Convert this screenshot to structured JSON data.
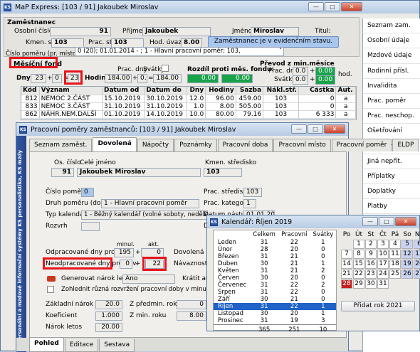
{
  "main_window": {
    "title": "MaP Express: [103 / 91] Jakoubek Miroslav",
    "section_employee": "Zaměstnanec",
    "osobni_cislo_label": "Osobní číslo",
    "osobni_cislo": "91",
    "prijmeni_label": "Příjmení",
    "prijmeni": "Jakoubek",
    "jmeno_label": "Jméno",
    "jmeno": "Miroslav",
    "titul_label": "Titul:",
    "kmen_str_label": "Kmen. stř.:",
    "kmen_str": "103",
    "prac_str_label": "Prac. stř.:",
    "prac_str": "103",
    "hod_uvazek_label": "Hod. úvazek",
    "hod_uvazek": "8.00",
    "status_button": "Zaměstnanec je v evidenčním stavu.",
    "cislo_pomeru_label": "Číslo poměru (pr. místo):",
    "cislo_pomeru_value": "0  (20); 01.01.2014 - ; 1 - Hlavní pracovní poměr; 103,",
    "mesicni_fond": "Měsíční fond",
    "prac_dny_label": "Prac. dny",
    "svatky_label": "Svátky",
    "dny_label": "Dny:",
    "dny_a": "23",
    "dny_b": "0",
    "dny_c": "23",
    "hodiny_label": "Hodiny:",
    "hodiny_a": "184.00",
    "hodiny_b": "0.00",
    "hodiny_c": "184.00",
    "rozdil_label": "Rozdíl proti měs. fondu:",
    "rozdil_a": "0.00",
    "rozdil_b": "0.00",
    "prevod_label": "Převod z min.měsíce",
    "prevod_prac_dny_label": "Prac. dny:",
    "prevod_svatky_label": "Svátky:",
    "prevod_dny": "0.0",
    "prevod_dny_hod": "0.00",
    "prevod_svatky": "0.0",
    "prevod_svatky_hod": "0.00",
    "hod_label": "hod."
  },
  "absence_table": {
    "columns": [
      "Kód",
      "Význam",
      "Datum od",
      "Datum do",
      "Dny",
      "Hodiny",
      "Sazba",
      "Nákl.stř.",
      "Částka",
      "Aut."
    ],
    "rows": [
      [
        "812",
        "NEMOC 2.ČÁST",
        "15.10.2019",
        "30.10.2019",
        "12.0",
        "96.00",
        "459.00",
        "103",
        "0",
        "a"
      ],
      [
        "833",
        "NEMOC 3.ČÁST",
        "31.10.2019",
        "31.10.2019",
        "1.0",
        "8.00",
        "505.00",
        "103",
        "0",
        "a"
      ],
      [
        "862",
        "NÁHR.NEM.DALŠÍ",
        "01.10.2019",
        "14.10.2019",
        "10.0",
        "80.00",
        "79.16",
        "103",
        "6 333",
        "a"
      ]
    ]
  },
  "sidebar": {
    "items": [
      "Seznam zam.",
      "Osobní údaje",
      "Mzdové údaje",
      "Rodinní přísl.",
      "Invalidita",
      "Prac. poměr",
      "Prac. neschop.",
      "Ošetřování",
      "Dovolená",
      "Jiná nepřít.",
      "Příplatky",
      "Doplatky",
      "Platby",
      "Pořizování dat",
      "Zprac. brutto",
      "Výúčtování"
    ],
    "active": "Zprac. brutto"
  },
  "pp_window": {
    "title": "Pracovní poměry zaměstnanců: [103 / 91] Jakoubek Miroslav",
    "vertical_text": "Personální a mzdové informační systémy KS personalistika, KS mzdy",
    "tabs": [
      "Seznam zaměst.",
      "Dovolená",
      "Nápočty",
      "Poznámky",
      "Pracovní doba",
      "Pracovní místo",
      "Pracovní poměr",
      "ELDP"
    ],
    "os_cislo_label": "Os. číslo",
    "cele_jmeno_label": "Celé jméno",
    "os_cislo": "91",
    "cele_jmeno": "Jakoubek Miroslav",
    "kmen_stredisko_label": "Kmen. středisko",
    "kmen_stredisko": "103",
    "cislo_pomeru_label": "Číslo poměru",
    "cislo_pomeru": "0",
    "druh_pomeru_label": "Druh poměru (dohody)",
    "druh_pomeru": "1 - Hlavní pracovní poměr",
    "typ_kalendare_label": "Typ kalendáře",
    "typ_kalendare": "1 - Běžný kalendář (volné soboty, neděle, svátky)",
    "rozvrh_label": "Rozvrh",
    "prac_stredisko_label": "Prac. středisko",
    "prac_stredisko": "103",
    "prac_kategorie_label": "Prac. kategorie",
    "prac_kategorie": "1",
    "datum_nastupu_label": "Datum nástupu",
    "datum_nastupu": "01.01.2014",
    "minul_label": "minul.",
    "akt_label": "akt.",
    "odpracovane_label": "Odpracované dny pro dov.",
    "odpracovane_minul": "195",
    "odpracovane_akt": "0",
    "neodpracovane_label": "Neodpracované dny pro dov.",
    "neodpracovane_minul": "0",
    "neodpracovane_akt": "22",
    "dovolena_label": "Dovolená u ext",
    "navaznost_label": "Návaznost zam",
    "generovat_label": "Generovat nárok letos",
    "generovat_value": "Ano",
    "kratit_label": "Krátit automatic",
    "zohlednit_label": "Zohlednit různá rozvržení pracovní doby v minulých obdobích",
    "zakladni_narok_label": "Základní nárok",
    "zakladni_narok": "20.0",
    "z_predmin_label": "Z předmin. roku",
    "z_predmin": "0",
    "koeficient_label": "Koeficient",
    "koeficient": "1.000",
    "z_min_label": "Z min. roku",
    "z_min": "8.00",
    "narok_letos_label": "Nárok letos",
    "narok_letos": "20.00",
    "bottom_tabs": [
      "Pohled",
      "Editace",
      "Sestava"
    ]
  },
  "calendar": {
    "title": "Kalendář: Říjen 2019",
    "columns": [
      "",
      "Celkem",
      "Pracovní",
      "Svátky"
    ],
    "months": [
      [
        "Leden",
        "31",
        "22",
        "1"
      ],
      [
        "Únor",
        "28",
        "20",
        "0"
      ],
      [
        "Březen",
        "31",
        "21",
        "0"
      ],
      [
        "Duben",
        "30",
        "21",
        "1"
      ],
      [
        "Květen",
        "31",
        "21",
        "2"
      ],
      [
        "Červen",
        "30",
        "20",
        "0"
      ],
      [
        "Červenec",
        "31",
        "22",
        "2"
      ],
      [
        "Srpen",
        "31",
        "22",
        "0"
      ],
      [
        "Září",
        "30",
        "21",
        "0"
      ],
      [
        "Říjen",
        "31",
        "22",
        "1"
      ],
      [
        "Listopad",
        "30",
        "20",
        "1"
      ],
      [
        "Prosinec",
        "31",
        "19",
        "3"
      ]
    ],
    "selected_month": "Říjen",
    "totals": [
      "365",
      "251",
      "10"
    ],
    "weekday_headers": [
      "Po",
      "Út",
      "St",
      "Čt",
      "Pá",
      "So",
      "Ne"
    ],
    "add_year_button": "Přidat rok 2021",
    "colors": {
      "weekend": "#c9d3f1",
      "holiday": "#c62020",
      "selected_row": "#1f62c8"
    }
  }
}
